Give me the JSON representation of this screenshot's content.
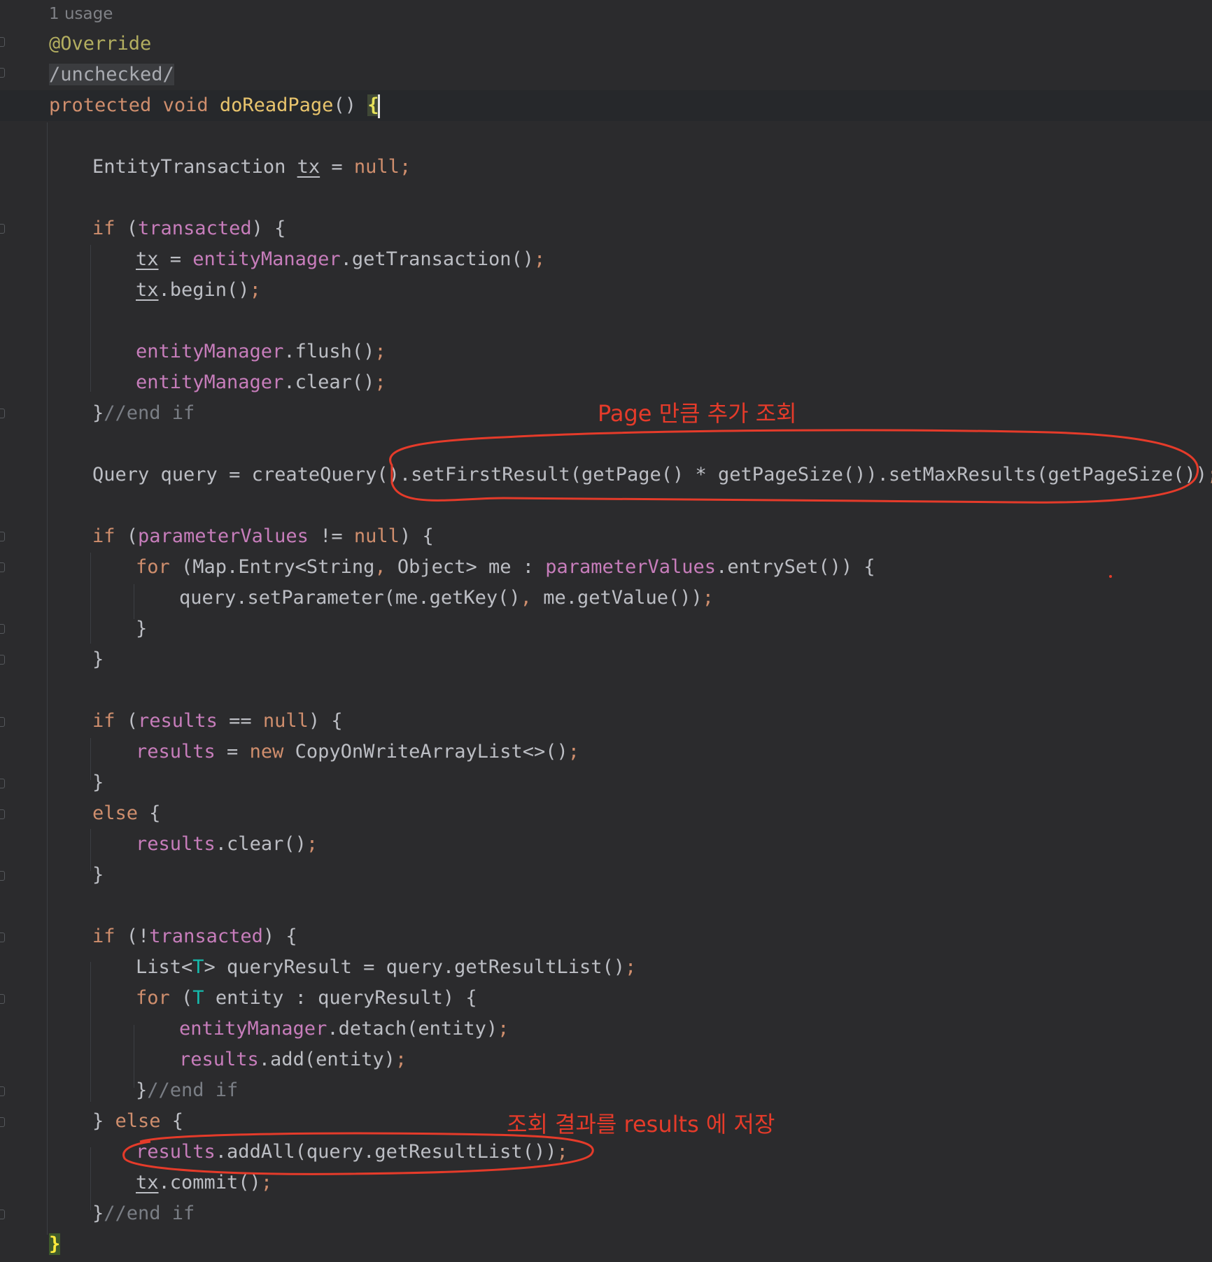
{
  "editor": {
    "usage_hint": "1 usage",
    "annotation": "@Override",
    "suppression": "/unchecked/",
    "signature": {
      "modifier": "protected",
      "type": "void",
      "method": "doReadPage",
      "parens": "() ",
      "open_brace": "{"
    },
    "lines": {
      "l1": {
        "a": "EntityTransaction ",
        "b": "tx",
        "c": " = ",
        "d": "null",
        "e": ";"
      },
      "l2": {
        "a": "if",
        "b": " (",
        "c": "transacted",
        "d": ") {"
      },
      "l3": {
        "a": "tx",
        "b": " = ",
        "c": "entityManager",
        "d": ".getTransaction()",
        "e": ";"
      },
      "l4": {
        "a": "tx",
        "b": ".begin()",
        "c": ";"
      },
      "l5": {
        "a": "entityManager",
        "b": ".flush()",
        "c": ";"
      },
      "l6": {
        "a": "entityManager",
        "b": ".clear()",
        "c": ";"
      },
      "l7": {
        "a": "}",
        "b": "//end if"
      },
      "l8": {
        "a": "Query query = createQuery().setFirstResult(getPage() * getPageSize()).setMaxResults(getPageSize())",
        "b": ";"
      },
      "l9": {
        "a": "if",
        "b": " (",
        "c": "parameterValues",
        "d": " != ",
        "e": "null",
        "f": ") {"
      },
      "l10": {
        "a": "for",
        "b": " (Map.Entry<String",
        "c": ",",
        "d": " Object> me : ",
        "e": "parameterValues",
        "f": ".entrySet()) {"
      },
      "l11": {
        "a": "query.setParameter(me.getKey()",
        "b": ",",
        "c": " me.getValue())",
        "d": ";"
      },
      "l12": {
        "a": "}"
      },
      "l13": {
        "a": "}"
      },
      "l14": {
        "a": "if",
        "b": " (",
        "c": "results",
        "d": " == ",
        "e": "null",
        "f": ") {"
      },
      "l15": {
        "a": "results",
        "b": " = ",
        "c": "new",
        "d": " CopyOnWriteArrayList<>()",
        "e": ";"
      },
      "l16": {
        "a": "}"
      },
      "l17": {
        "a": "else",
        "b": " {"
      },
      "l18": {
        "a": "results",
        "b": ".clear()",
        "c": ";"
      },
      "l19": {
        "a": "}"
      },
      "l20": {
        "a": "if",
        "b": " (!",
        "c": "transacted",
        "d": ") {"
      },
      "l21": {
        "a": "List<",
        "b": "T",
        "c": "> queryResult = query.getResultList()",
        "d": ";"
      },
      "l22": {
        "a": "for",
        "b": " (",
        "c": "T",
        "d": " entity : queryResult) {"
      },
      "l23": {
        "a": "entityManager",
        "b": ".detach(entity)",
        "c": ";"
      },
      "l24": {
        "a": "results",
        "b": ".add(entity)",
        "c": ";"
      },
      "l25": {
        "a": "}",
        "b": "//end if"
      },
      "l26": {
        "a": "} ",
        "b": "else",
        "c": " {"
      },
      "l27": {
        "a": "results",
        "b": ".addAll(query.getResultList())",
        "c": ";"
      },
      "l28": {
        "a": "tx",
        "b": ".commit()",
        "c": ";"
      },
      "l29": {
        "a": "}",
        "b": "//end if"
      },
      "l30": {
        "a": "}"
      }
    }
  },
  "annotations": {
    "note1": "Page 만큼 추가 조회",
    "note2": "조회 결과를 results 에 저장"
  },
  "colors": {
    "background": "#2b2b2d",
    "keyword": "#cf8e6d",
    "field": "#c77dbb",
    "method_decl": "#e8c46d",
    "comment": "#7a7e85",
    "markup_red": "#e53b2a"
  }
}
